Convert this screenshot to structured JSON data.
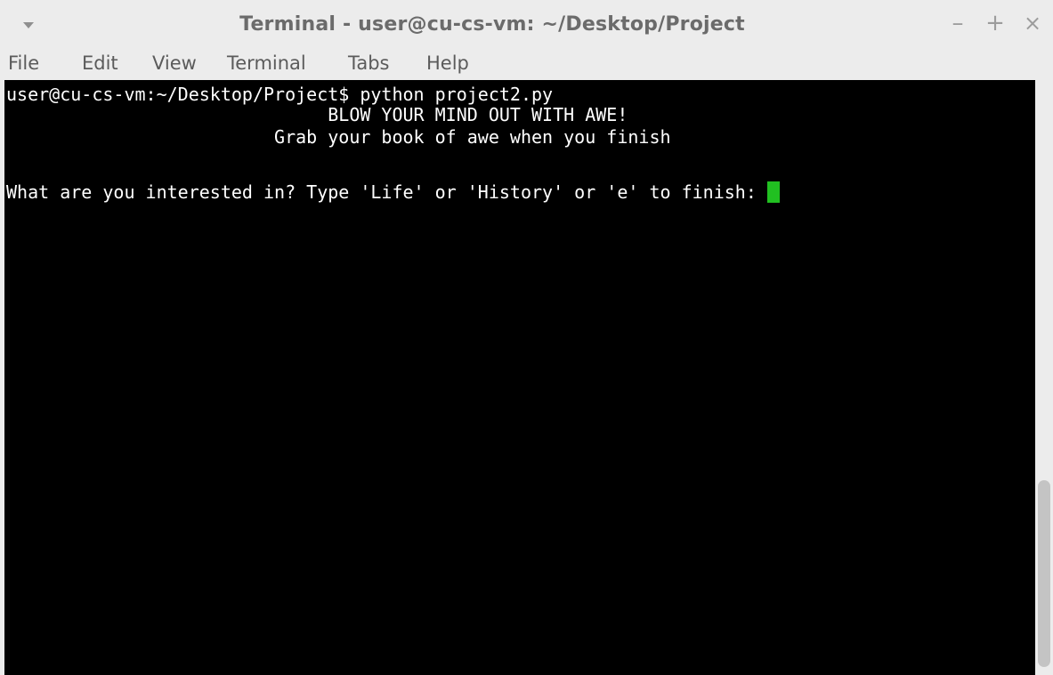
{
  "window": {
    "title": "Terminal - user@cu-cs-vm: ~/Desktop/Project",
    "buttons": {
      "minimize": "–",
      "maximize": "+",
      "close": "×"
    }
  },
  "menu": {
    "file": "File",
    "edit": "Edit",
    "view": "View",
    "terminal": "Terminal",
    "tabs": "Tabs",
    "help": "Help"
  },
  "terminal": {
    "lines": {
      "command": "user@cu-cs-vm:~/Desktop/Project$ python project2.py",
      "banner": "                              BLOW YOUR MIND OUT WITH AWE!",
      "subtitle": "                         Grab your book of awe when you finish",
      "prompt": "What are you interested in? Type 'Life' or 'History' or 'e' to finish:"
    },
    "colors": {
      "background": "#000000",
      "text": "#ffffff",
      "cursor": "#21c021"
    }
  },
  "icons": {
    "window_menu": "chevron-down-icon",
    "minimize": "minimize-icon",
    "maximize": "maximize-icon",
    "close": "close-icon"
  }
}
